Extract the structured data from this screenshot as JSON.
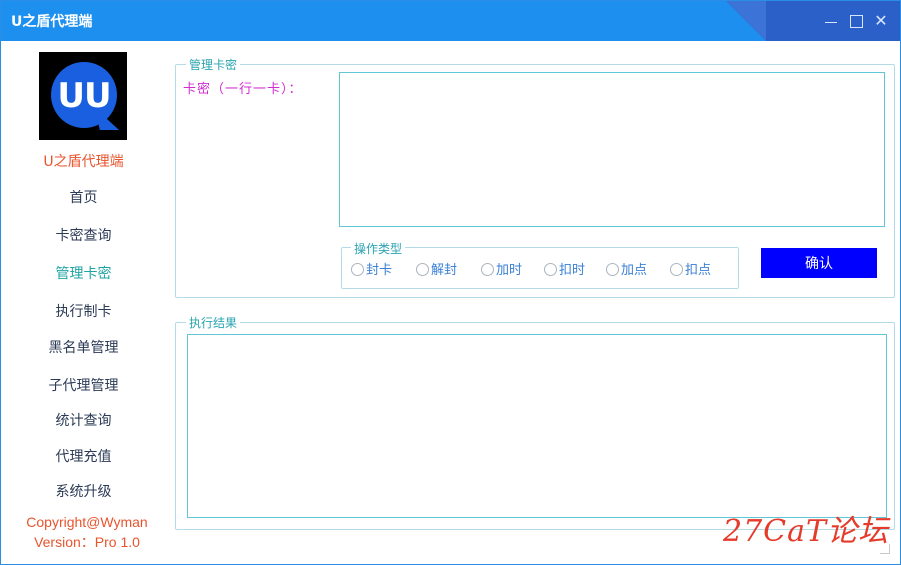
{
  "window": {
    "title": "U之盾代理端"
  },
  "sidebar": {
    "logo_text": "UU",
    "brand": "U之盾代理端",
    "items": [
      {
        "label": "首页",
        "active": false
      },
      {
        "label": "卡密查询",
        "active": false
      },
      {
        "label": "管理卡密",
        "active": true
      },
      {
        "label": "执行制卡",
        "active": false
      },
      {
        "label": "黑名单管理",
        "active": false
      },
      {
        "label": "子代理管理",
        "active": false
      },
      {
        "label": "统计查询",
        "active": false
      },
      {
        "label": "代理充值",
        "active": false
      },
      {
        "label": "系统升级",
        "active": false
      }
    ],
    "copyright": "Copyright@Wyman",
    "version": "Version：Pro 1.0"
  },
  "manage": {
    "group_title": "管理卡密",
    "input_label": "卡密（一行一卡）：",
    "input_value": "",
    "op_group_title": "操作类型",
    "options": [
      "封卡",
      "解封",
      "加时",
      "扣时",
      "加点",
      "扣点"
    ],
    "confirm_label": "确认"
  },
  "result": {
    "group_title": "执行结果",
    "value": ""
  },
  "watermark": "27CaT论坛",
  "colors": {
    "titlebar": "#1d8fee",
    "accent_pink": "#d22bd2",
    "brand_orange": "#e8542d",
    "active_teal": "#1fa3a3",
    "confirm_blue": "#0000ff"
  }
}
